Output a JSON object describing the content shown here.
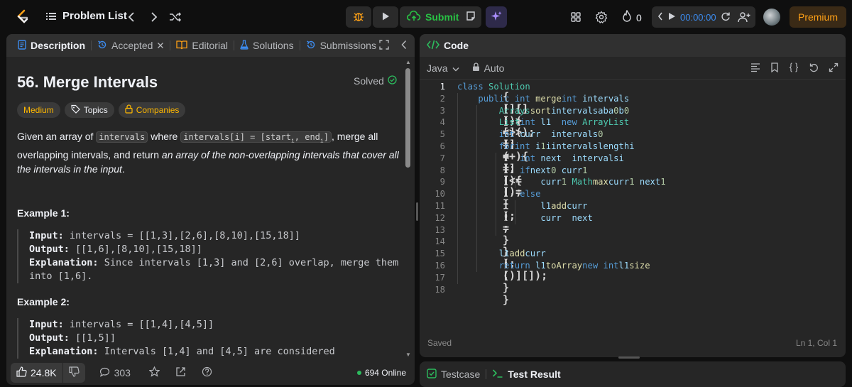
{
  "topbar": {
    "problem_list_label": "Problem List",
    "submit_label": "Submit",
    "streak_count": "0",
    "timer": "00:00:00",
    "premium_label": "Premium"
  },
  "left_tabs": [
    {
      "label": "Description"
    },
    {
      "label": "Accepted"
    },
    {
      "label": "Editorial"
    },
    {
      "label": "Solutions"
    },
    {
      "label": "Submissions"
    }
  ],
  "problem": {
    "title": "56. Merge Intervals",
    "solved_label": "Solved",
    "difficulty": "Medium",
    "topics_label": "Topics",
    "companies_label": "Companies",
    "desc_part1": "Given an array of ",
    "desc_code1": "intervals",
    "desc_part2": " where ",
    "desc_code2": "intervals[i] = [start",
    "desc_sub1": "i",
    "desc_code3": ", end",
    "desc_sub2": "i",
    "desc_code4": "]",
    "desc_part3": ", merge all overlapping intervals, and return ",
    "desc_em": "an array of the non-overlapping intervals that cover all the intervals in the input",
    "desc_end": "."
  },
  "examples": [
    {
      "title": "Example 1:",
      "input_label": "Input:",
      "input": "intervals = [[1,3],[2,6],[8,10],[15,18]]",
      "output_label": "Output:",
      "output": "[[1,6],[8,10],[15,18]]",
      "explanation_label": "Explanation:",
      "explanation_1": "Since intervals [1,3] and [2,6] overlap, merge them",
      "explanation_2": "into [1,6]."
    },
    {
      "title": "Example 2:",
      "input_label": "Input:",
      "input": "intervals = [[1,4],[4,5]]",
      "output_label": "Output:",
      "output": "[[1,5]]",
      "explanation_label": "Explanation:",
      "explanation_1": "Intervals [1,4] and [4,5] are considered"
    }
  ],
  "footer": {
    "likes": "24.8K",
    "comments": "303",
    "online": "694 Online"
  },
  "code_panel": {
    "header": "Code",
    "language": "Java",
    "mode": "Auto",
    "saved_label": "Saved",
    "cursor_pos": "Ln 1, Col 1",
    "line_numbers": [
      "1",
      "2",
      "3",
      "4",
      "5",
      "6",
      "7",
      "8",
      "9",
      "10",
      "11",
      "12",
      "13",
      "14",
      "15",
      "16",
      "17",
      "18"
    ]
  },
  "bottom_tabs": {
    "testcase_label": "Testcase",
    "test_result_label": "Test Result"
  },
  "colors": {
    "accent_green": "#28c244",
    "premium_orange": "#ffa116",
    "medium_yellow": "#ffb800",
    "timer_blue": "#3c8cf0"
  }
}
